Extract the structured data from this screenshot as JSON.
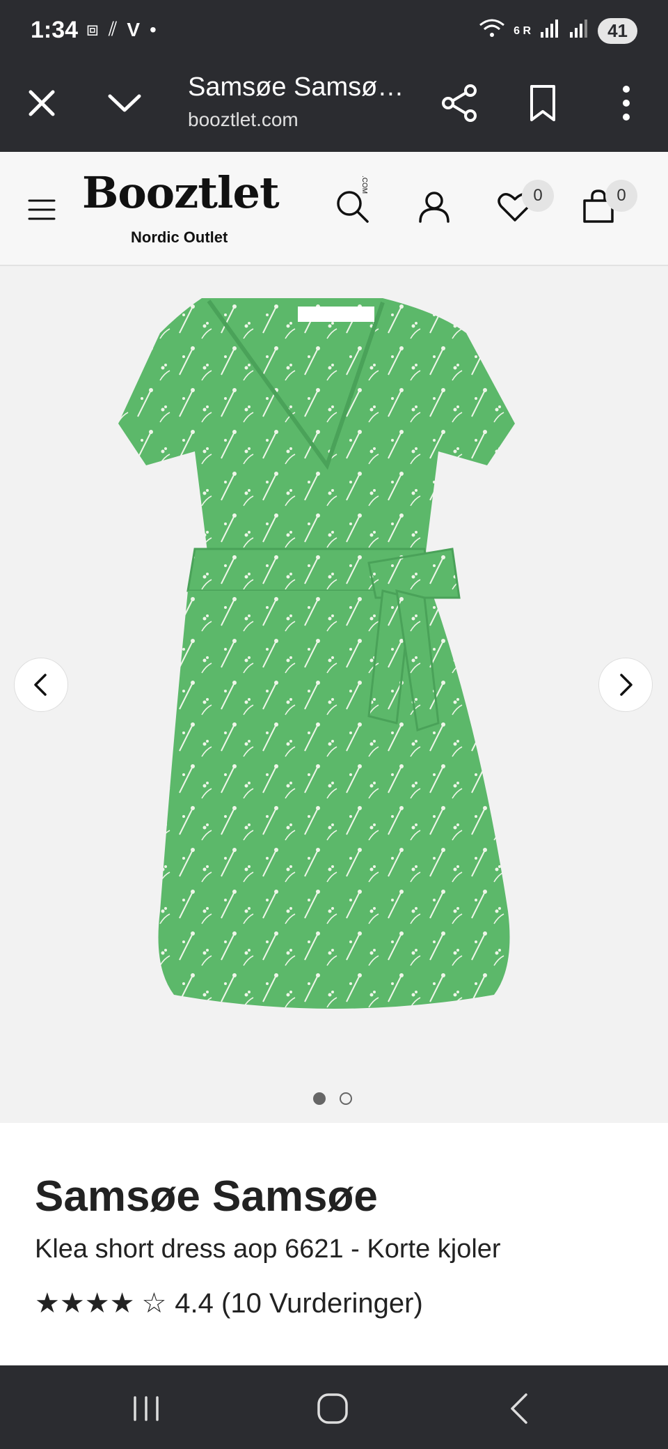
{
  "status_bar": {
    "time": "1:34",
    "left_icons": [
      "screenshot-icon",
      "signal-dash-icon",
      "v-icon",
      "dot-icon"
    ],
    "signal_text": "6 R",
    "battery": "41"
  },
  "browser": {
    "title": "Samsøe Samsø…",
    "url": "booztlet.com"
  },
  "site_header": {
    "logo": "Booztlet",
    "logo_com": ".COM",
    "tagline": "Nordic Outlet",
    "wishlist_count": "0",
    "cart_count": "0"
  },
  "gallery": {
    "image_alt": "Green floral short wrap dress",
    "slides": 2,
    "active_slide": 1
  },
  "product": {
    "brand": "Samsøe Samsøe",
    "name": "Klea short dress aop 6621 - Korte kjoler",
    "stars_filled": 4,
    "stars_total": 5,
    "star_full": "★★★★",
    "star_empty": "☆",
    "rating_text": "4.4 (10 Vurderinger)"
  },
  "colors": {
    "dark_bar": "#2b2c30",
    "dress_green": "#5cb86a"
  }
}
